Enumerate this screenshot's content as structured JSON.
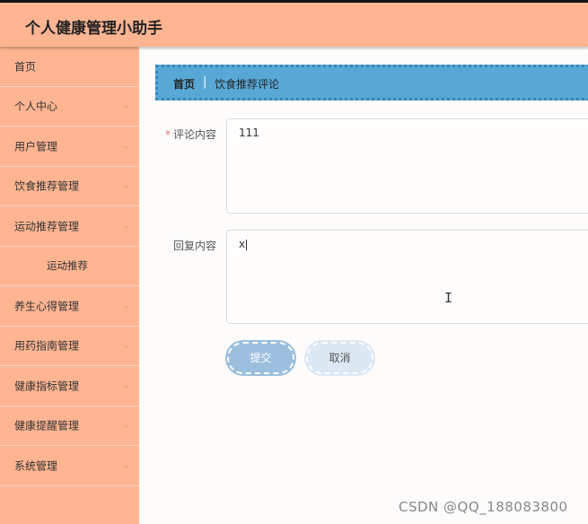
{
  "app": {
    "title": "个人健康管理小助手"
  },
  "sidebar": {
    "items": [
      {
        "label": "首页",
        "has_chevron": false
      },
      {
        "label": "个人中心",
        "has_chevron": true
      },
      {
        "label": "用户管理",
        "has_chevron": true
      },
      {
        "label": "饮食推荐管理",
        "has_chevron": true
      },
      {
        "label": "运动推荐管理",
        "has_chevron": true
      },
      {
        "label": "运动推荐",
        "sub": true
      },
      {
        "label": "养生心得管理",
        "has_chevron": true
      },
      {
        "label": "用药指南管理",
        "has_chevron": true
      },
      {
        "label": "健康指标管理",
        "has_chevron": true
      },
      {
        "label": "健康提醒管理",
        "has_chevron": true
      },
      {
        "label": "系统管理",
        "has_chevron": true
      }
    ],
    "chevron_icon": "chevron-down-icon"
  },
  "breadcrumb": {
    "home": "首页",
    "separator": "|",
    "current": "饮食推荐评论"
  },
  "form": {
    "comment_label": "评论内容",
    "required_mark": "*",
    "comment_value": "111",
    "reply_label": "回复内容",
    "reply_value": "x",
    "submit_label": "提交",
    "cancel_label": "取消"
  },
  "watermark": "CSDN @QQ_188083800",
  "colors": {
    "sidebar": "#ffb592",
    "header": "#ffb592",
    "breadcrumb": "#58a8d6",
    "submit": "#9bbfdd",
    "cancel": "#dce8f4"
  }
}
